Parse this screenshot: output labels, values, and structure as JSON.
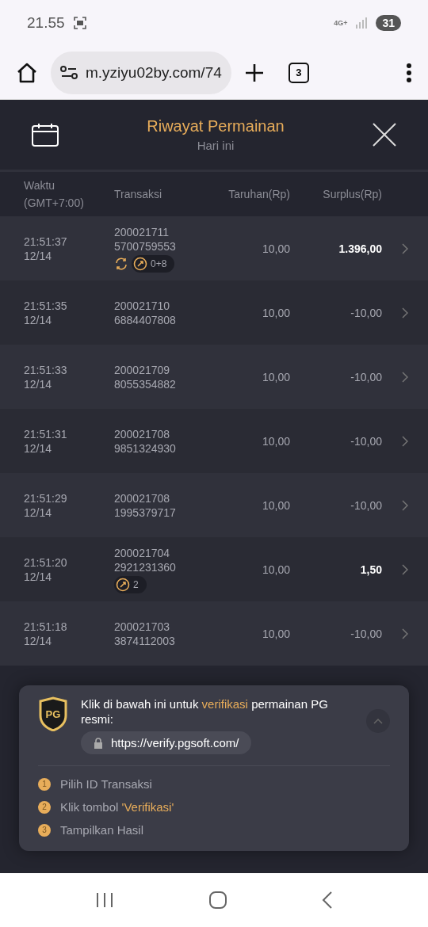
{
  "status_bar": {
    "time": "21.55",
    "network": "4G+",
    "battery": "31"
  },
  "browser": {
    "url": "m.yziyu02by.com/74",
    "tab_count": "3"
  },
  "header": {
    "title": "Riwayat Permainan",
    "subtitle": "Hari ini"
  },
  "table": {
    "columns": [
      {
        "lines": [
          "Waktu",
          "(GMT+7:00)"
        ]
      },
      {
        "lines": [
          "Transaksi"
        ]
      },
      {
        "lines": [
          "Taruhan(Rp)"
        ]
      },
      {
        "lines": [
          "Surplus(Rp)"
        ]
      }
    ],
    "rows": [
      {
        "time": "21:51:37",
        "date": "12/14",
        "id_1": "200021711",
        "id_2": "5700759553",
        "bet": "10,00",
        "surplus": "1.396,00",
        "win": true,
        "respin": true,
        "badge": "0+8"
      },
      {
        "time": "21:51:35",
        "date": "12/14",
        "id_1": "200021710",
        "id_2": "6884407808",
        "bet": "10,00",
        "surplus": "-10,00",
        "win": false,
        "respin": false
      },
      {
        "time": "21:51:33",
        "date": "12/14",
        "id_1": "200021709",
        "id_2": "8055354882",
        "bet": "10,00",
        "surplus": "-10,00",
        "win": false,
        "respin": false
      },
      {
        "time": "21:51:31",
        "date": "12/14",
        "id_1": "200021708",
        "id_2": "9851324930",
        "bet": "10,00",
        "surplus": "-10,00",
        "win": false,
        "respin": false
      },
      {
        "time": "21:51:29",
        "date": "12/14",
        "id_1": "200021708",
        "id_2": "1995379717",
        "bet": "10,00",
        "surplus": "-10,00",
        "win": false,
        "respin": false
      },
      {
        "time": "21:51:20",
        "date": "12/14",
        "id_1": "200021704",
        "id_2": "2921231360",
        "bet": "10,00",
        "surplus": "1,50",
        "win": true,
        "respin": false,
        "badge": "2"
      },
      {
        "time": "21:51:18",
        "date": "12/14",
        "id_1": "200021703",
        "id_2": "3874112003",
        "bet": "10,00",
        "surplus": "-10,00",
        "win": false,
        "respin": false
      }
    ]
  },
  "verify_card": {
    "logo": "PG",
    "intro": [
      {
        "text": "Klik di bawah ini untuk",
        "highlight": false
      },
      {
        "text": "verifikasi",
        "highlight": true
      },
      {
        "text": "permainan PG resmi:",
        "highlight": false
      }
    ],
    "link": "https://verify.pgsoft.com/",
    "expanded": true,
    "steps": [
      {
        "number": "1",
        "text": "Pilih ID Transaksi"
      },
      {
        "number": "2",
        "text": "Klik tombol",
        "highlight": "'Verifikasi'"
      },
      {
        "number": "3",
        "text": "Tampilkan Hasil"
      }
    ]
  }
}
